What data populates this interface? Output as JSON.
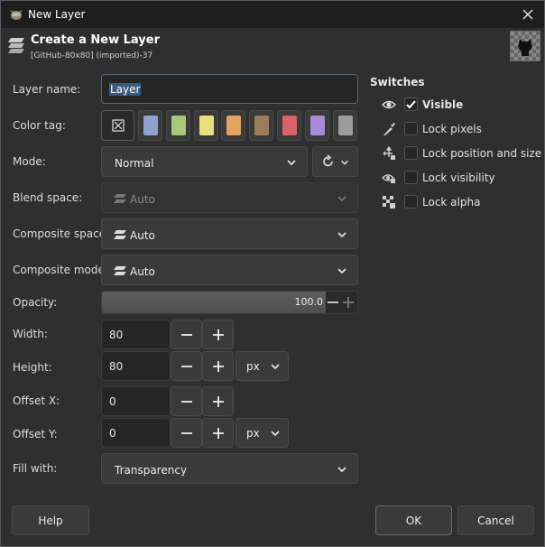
{
  "window": {
    "title": "New Layer",
    "close_label": "✕"
  },
  "header": {
    "title": "Create a New Layer",
    "subtitle": "[GitHub-80x80] (imported)-37"
  },
  "form": {
    "layer_name_label": "Layer name:",
    "layer_name_value": "Layer",
    "color_tag_label": "Color tag:",
    "color_tags": [
      "#8fa2c9",
      "#a9c77b",
      "#e8df7f",
      "#e3a463",
      "#9b7d5d",
      "#d9626a",
      "#a88ad8",
      "#9c9c9c"
    ],
    "mode_label": "Mode:",
    "mode_value": "Normal",
    "blend_space_label": "Blend space:",
    "blend_space_value": "Auto",
    "composite_space_label": "Composite space:",
    "composite_space_value": "Auto",
    "composite_mode_label": "Composite mode:",
    "composite_mode_value": "Auto",
    "opacity_label": "Opacity:",
    "opacity_value": "100.0",
    "width_label": "Width:",
    "width_value": "80",
    "height_label": "Height:",
    "height_value": "80",
    "size_unit": "px",
    "offset_x_label": "Offset X:",
    "offset_x_value": "0",
    "offset_y_label": "Offset Y:",
    "offset_y_value": "0",
    "offset_unit": "px",
    "fill_label": "Fill with:",
    "fill_value": "Transparency"
  },
  "switches": {
    "heading": "Switches",
    "items": [
      {
        "label": "Visible",
        "checked": true
      },
      {
        "label": "Lock pixels",
        "checked": false
      },
      {
        "label": "Lock position and size",
        "checked": false
      },
      {
        "label": "Lock visibility",
        "checked": false
      },
      {
        "label": "Lock alpha",
        "checked": false
      }
    ]
  },
  "buttons": {
    "help": "Help",
    "ok": "OK",
    "cancel": "Cancel"
  }
}
